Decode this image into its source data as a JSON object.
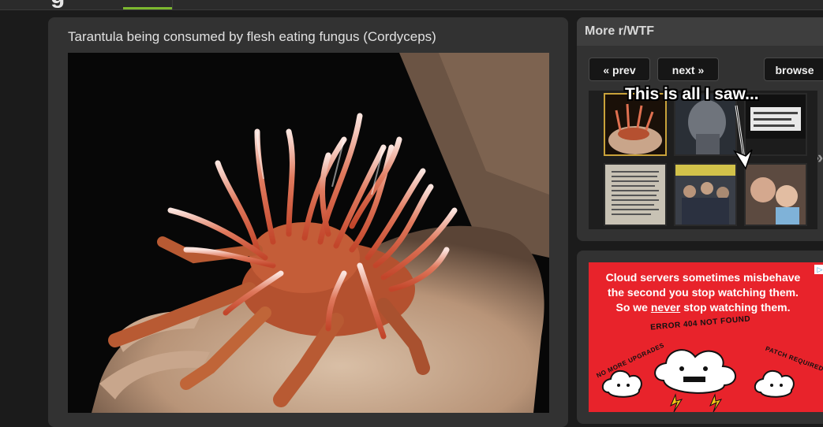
{
  "post": {
    "title": "Tarantula being consumed by flesh eating fungus (Cordyceps)"
  },
  "sidebar": {
    "title": "More r/WTF",
    "prev_label": "« prev",
    "next_label": "next »",
    "browse_label": "browse",
    "overlay_caption": "This is all I saw...",
    "left_chevron": "«",
    "right_chevron": "»"
  },
  "ad": {
    "line1": "Cloud servers sometimes misbehave",
    "line2": "the second you stop watching them.",
    "line3_pre": "So we ",
    "line3_em": "never",
    "line3_post": " stop watching them.",
    "error_text": "ERROR 404 NOT FOUND",
    "left_text": "NO MORE UPGRADES",
    "right_text": "PATCH REQUIRED",
    "badge_icon": "adchoices-icon"
  },
  "colors": {
    "accent_green": "#7cb82f",
    "selected_thumb_border": "#c9a23a",
    "ad_red": "#e8232b"
  }
}
